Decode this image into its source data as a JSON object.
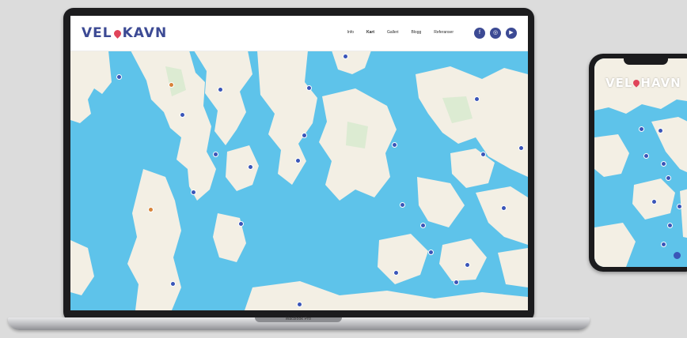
{
  "site": {
    "logo_left": "VEL",
    "logo_right": "KAVN",
    "nav": [
      "Info",
      "Kart",
      "Galleri",
      "Blogg",
      "Referanser"
    ],
    "active_nav": "Kart",
    "social_icons": [
      "facebook-icon",
      "instagram-icon",
      "youtube-icon"
    ],
    "brand_color": "#3c4a94",
    "accent_color": "#e0445a"
  },
  "laptop": {
    "model_label": "MacBook Pro"
  },
  "phone": {
    "logo_left": "VEL",
    "logo_right": "HAVN",
    "zoom_in": "+",
    "zoom_out": "−"
  },
  "map": {
    "water_color": "#5ec3ea",
    "land_color": "#f3efe4"
  }
}
